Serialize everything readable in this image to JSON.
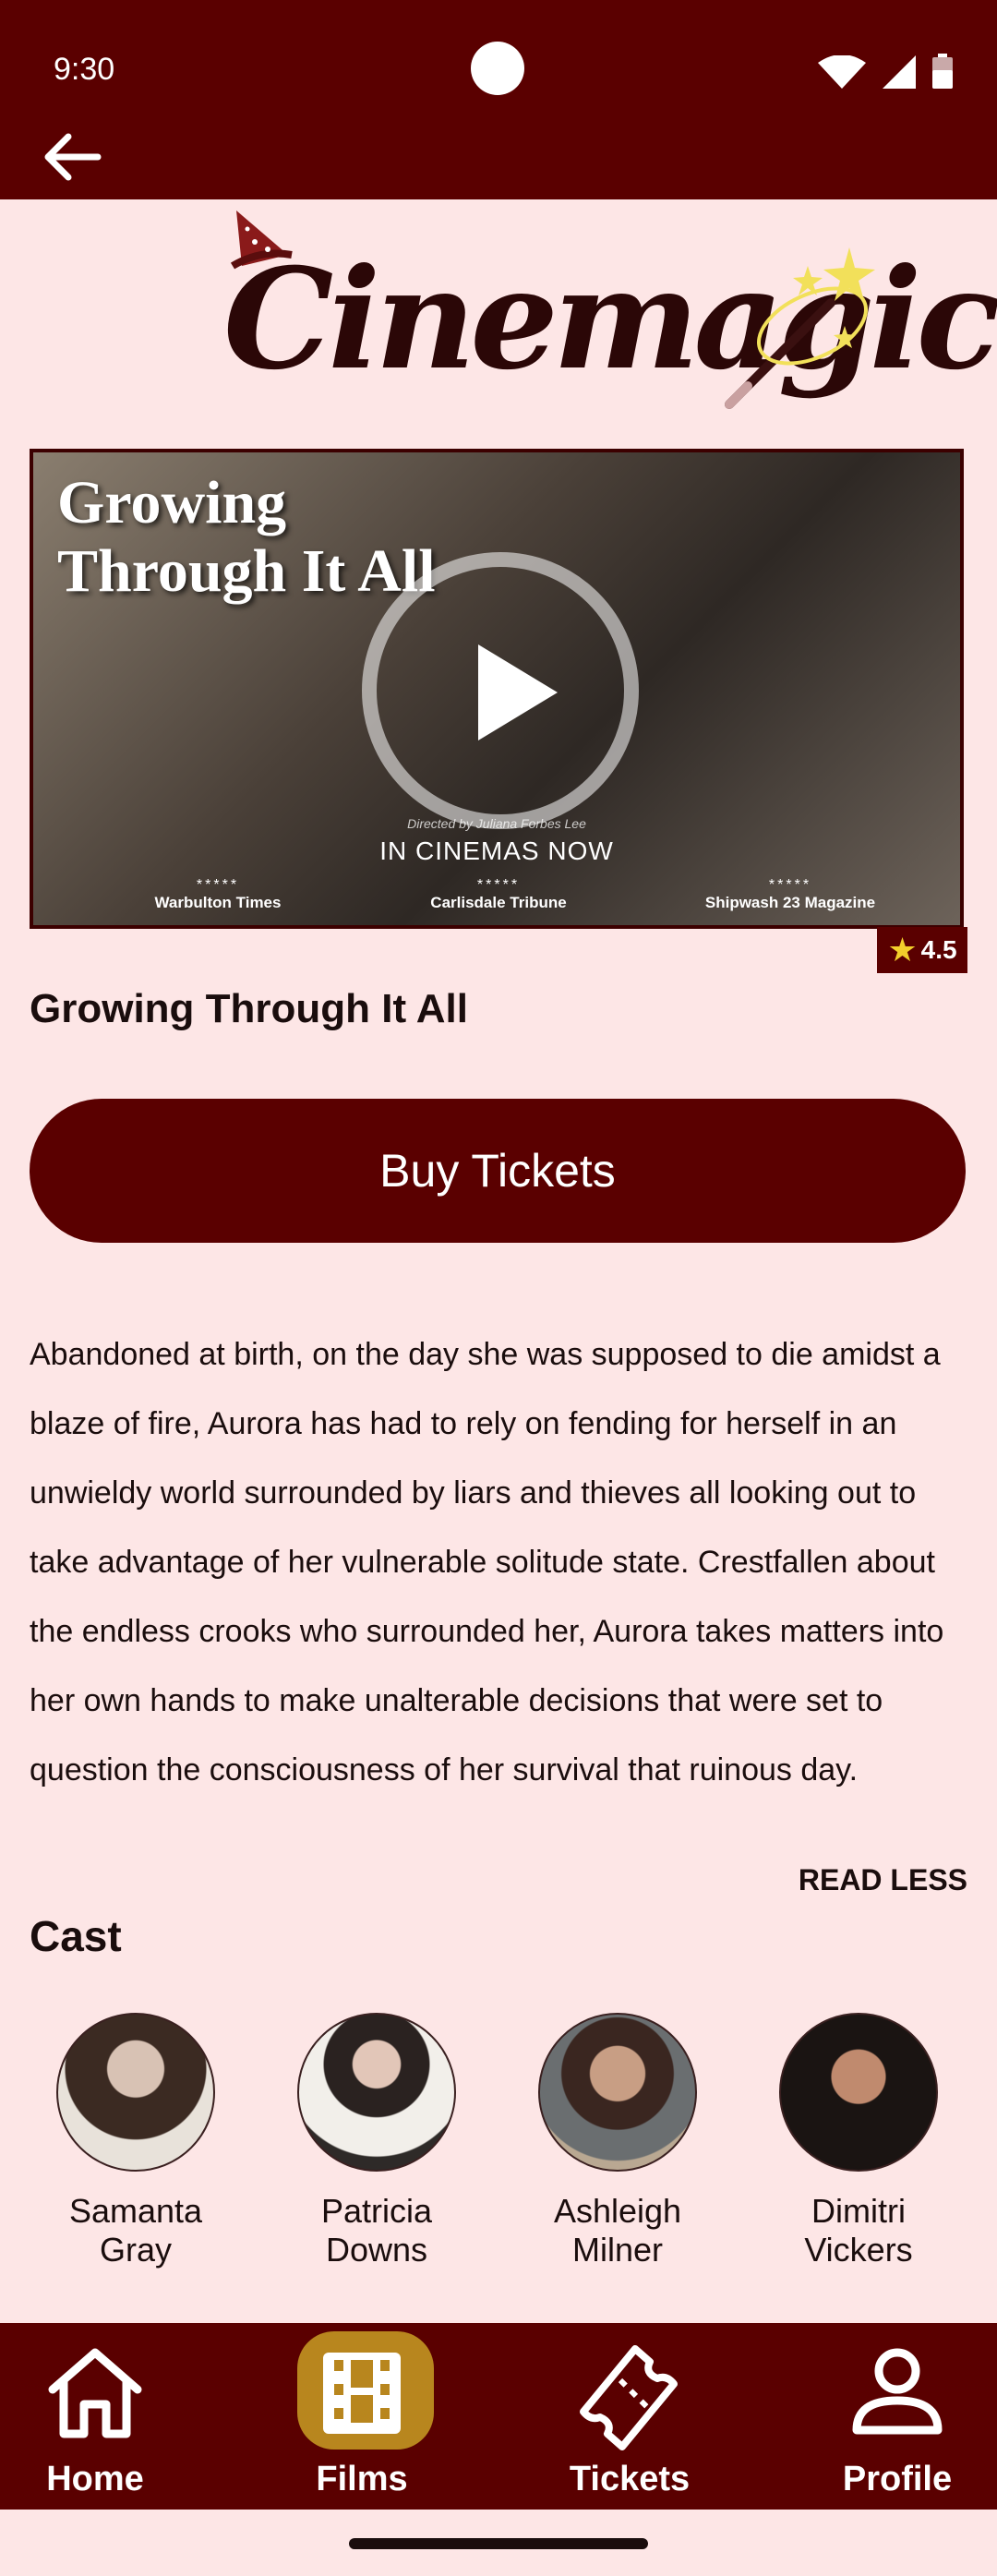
{
  "status_bar": {
    "time": "9:30"
  },
  "header": {
    "back_icon": "arrow-left-icon"
  },
  "logo": {
    "text": "Cinemagic",
    "icons": [
      "wizard-hat-icon",
      "magic-wand-icon"
    ]
  },
  "trailer": {
    "title": "Growing\nThrough It All",
    "directed_by": "Directed by Juliana Forbes Lee",
    "tagline": "IN CINEMAS NOW",
    "play_icon": "play-icon",
    "reviews": [
      {
        "stars": "*****",
        "source": "Warbulton Times"
      },
      {
        "stars": "*****",
        "source": "Carlisdale Tribune"
      },
      {
        "stars": "*****",
        "source": "Shipwash 23 Magazine"
      }
    ]
  },
  "rating": {
    "icon": "star-icon",
    "value": "4.5"
  },
  "film": {
    "title": "Growing Through It All",
    "buy_label": "Buy Tickets",
    "synopsis": "Abandoned at birth, on the day she was supposed to die amidst a blaze of fire, Aurora has had to rely on fending for herself in an unwieldy world surrounded by liars and thieves all looking out to take advantage of her vulnerable solitude state. Crestfallen about the endless crooks who surrounded her, Aurora takes matters into her own hands to make unalterable decisions that were set to question the consciousness of her survival that ruinous day.",
    "read_less": "READ LESS"
  },
  "cast": {
    "title": "Cast",
    "members": [
      {
        "name": "Samanta\nGray"
      },
      {
        "name": "Patricia\nDowns"
      },
      {
        "name": "Ashleigh\nMilner"
      },
      {
        "name": "Dimitri\nVickers"
      }
    ]
  },
  "nav": {
    "items": [
      {
        "label": "Home",
        "icon": "home-icon"
      },
      {
        "label": "Films",
        "icon": "film-icon",
        "active": true
      },
      {
        "label": "Tickets",
        "icon": "ticket-icon"
      },
      {
        "label": "Profile",
        "icon": "profile-icon"
      }
    ]
  },
  "colors": {
    "primary": "#5a0000",
    "background": "#fde6e6",
    "active_pill": "#b8861e",
    "star": "#f2cf2b"
  }
}
